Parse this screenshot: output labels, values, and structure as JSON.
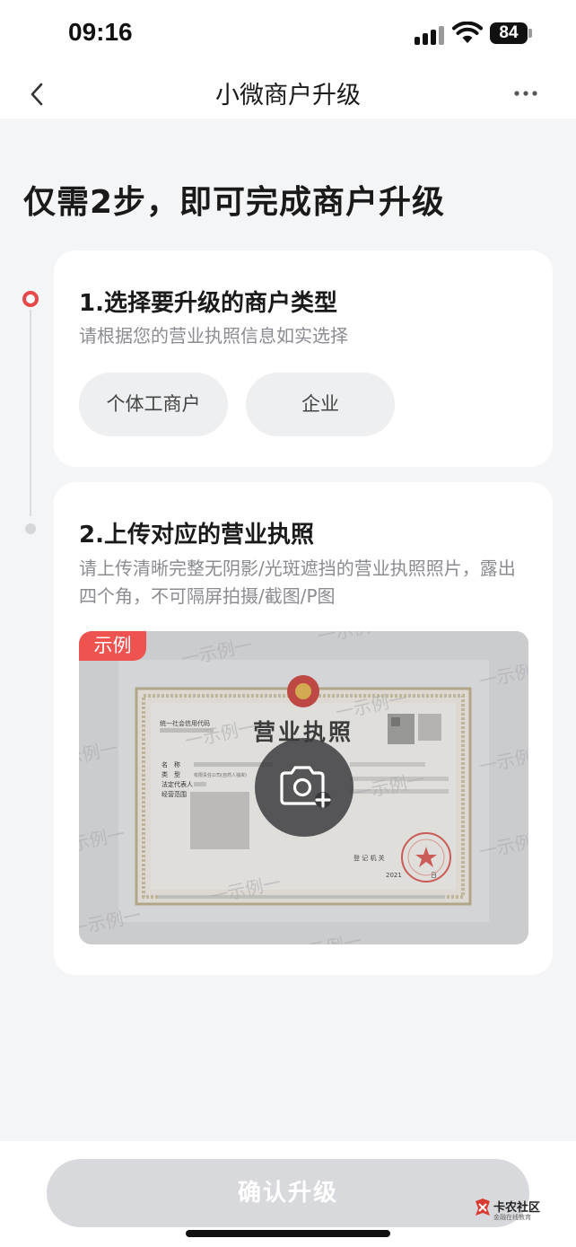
{
  "status_bar": {
    "time": "09:16",
    "battery": "84"
  },
  "nav": {
    "title": "小微商户升级",
    "back_icon": "chevron-left-icon",
    "more_icon": "more-horizontal-icon"
  },
  "headline": "仅需2步，即可完成商户升级",
  "steps": [
    {
      "title": "1.选择要升级的商户类型",
      "description": "请根据您的营业执照信息如实选择",
      "options": [
        "个体工商户",
        "企业"
      ]
    },
    {
      "title": "2.上传对应的营业执照",
      "description": "请上传清晰完整无阴影/光斑遮挡的营业执照照片，露出四个角，不可隔屏拍摄/截图/P图",
      "sample_badge": "示例",
      "sample_license": {
        "title": "营业执照",
        "watermark_text": "一示例一",
        "credit_code_label": "统一社会信用代码",
        "fields": [
          "名　称",
          "类　型",
          "法定代表人",
          "经营范围"
        ],
        "type_value": "有限责任公司(自然人独资)",
        "registration_label": "登 记 机 关",
        "date_prefix": "2021",
        "date_suffix": "日"
      },
      "upload_icon": "camera-add-icon"
    }
  ],
  "footer": {
    "confirm_label": "确认升级"
  },
  "watermark": {
    "main": "卡农社区",
    "sub": "金融在线教育"
  },
  "colors": {
    "accent": "#e8484a",
    "badge": "#ef5350",
    "button_disabled": "#d8d9dc",
    "background": "#f4f5f7"
  }
}
